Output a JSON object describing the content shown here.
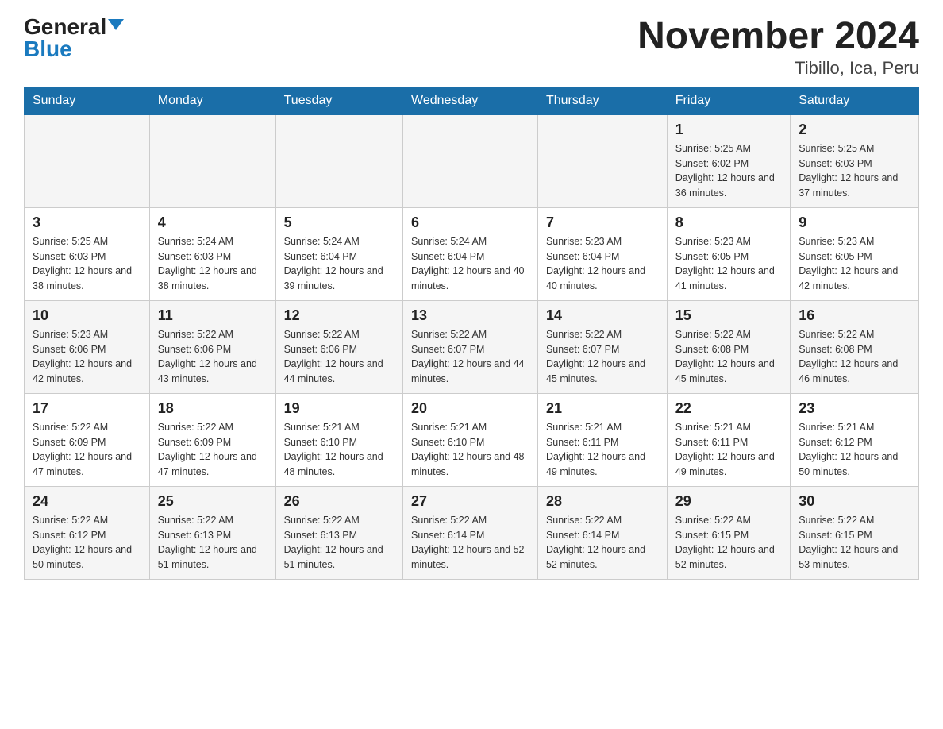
{
  "header": {
    "logo_general": "General",
    "logo_blue": "Blue",
    "title": "November 2024",
    "subtitle": "Tibillo, Ica, Peru"
  },
  "days_of_week": [
    "Sunday",
    "Monday",
    "Tuesday",
    "Wednesday",
    "Thursday",
    "Friday",
    "Saturday"
  ],
  "weeks": [
    [
      {
        "day": "",
        "sunrise": "",
        "sunset": "",
        "daylight": ""
      },
      {
        "day": "",
        "sunrise": "",
        "sunset": "",
        "daylight": ""
      },
      {
        "day": "",
        "sunrise": "",
        "sunset": "",
        "daylight": ""
      },
      {
        "day": "",
        "sunrise": "",
        "sunset": "",
        "daylight": ""
      },
      {
        "day": "",
        "sunrise": "",
        "sunset": "",
        "daylight": ""
      },
      {
        "day": "1",
        "sunrise": "Sunrise: 5:25 AM",
        "sunset": "Sunset: 6:02 PM",
        "daylight": "Daylight: 12 hours and 36 minutes."
      },
      {
        "day": "2",
        "sunrise": "Sunrise: 5:25 AM",
        "sunset": "Sunset: 6:03 PM",
        "daylight": "Daylight: 12 hours and 37 minutes."
      }
    ],
    [
      {
        "day": "3",
        "sunrise": "Sunrise: 5:25 AM",
        "sunset": "Sunset: 6:03 PM",
        "daylight": "Daylight: 12 hours and 38 minutes."
      },
      {
        "day": "4",
        "sunrise": "Sunrise: 5:24 AM",
        "sunset": "Sunset: 6:03 PM",
        "daylight": "Daylight: 12 hours and 38 minutes."
      },
      {
        "day": "5",
        "sunrise": "Sunrise: 5:24 AM",
        "sunset": "Sunset: 6:04 PM",
        "daylight": "Daylight: 12 hours and 39 minutes."
      },
      {
        "day": "6",
        "sunrise": "Sunrise: 5:24 AM",
        "sunset": "Sunset: 6:04 PM",
        "daylight": "Daylight: 12 hours and 40 minutes."
      },
      {
        "day": "7",
        "sunrise": "Sunrise: 5:23 AM",
        "sunset": "Sunset: 6:04 PM",
        "daylight": "Daylight: 12 hours and 40 minutes."
      },
      {
        "day": "8",
        "sunrise": "Sunrise: 5:23 AM",
        "sunset": "Sunset: 6:05 PM",
        "daylight": "Daylight: 12 hours and 41 minutes."
      },
      {
        "day": "9",
        "sunrise": "Sunrise: 5:23 AM",
        "sunset": "Sunset: 6:05 PM",
        "daylight": "Daylight: 12 hours and 42 minutes."
      }
    ],
    [
      {
        "day": "10",
        "sunrise": "Sunrise: 5:23 AM",
        "sunset": "Sunset: 6:06 PM",
        "daylight": "Daylight: 12 hours and 42 minutes."
      },
      {
        "day": "11",
        "sunrise": "Sunrise: 5:22 AM",
        "sunset": "Sunset: 6:06 PM",
        "daylight": "Daylight: 12 hours and 43 minutes."
      },
      {
        "day": "12",
        "sunrise": "Sunrise: 5:22 AM",
        "sunset": "Sunset: 6:06 PM",
        "daylight": "Daylight: 12 hours and 44 minutes."
      },
      {
        "day": "13",
        "sunrise": "Sunrise: 5:22 AM",
        "sunset": "Sunset: 6:07 PM",
        "daylight": "Daylight: 12 hours and 44 minutes."
      },
      {
        "day": "14",
        "sunrise": "Sunrise: 5:22 AM",
        "sunset": "Sunset: 6:07 PM",
        "daylight": "Daylight: 12 hours and 45 minutes."
      },
      {
        "day": "15",
        "sunrise": "Sunrise: 5:22 AM",
        "sunset": "Sunset: 6:08 PM",
        "daylight": "Daylight: 12 hours and 45 minutes."
      },
      {
        "day": "16",
        "sunrise": "Sunrise: 5:22 AM",
        "sunset": "Sunset: 6:08 PM",
        "daylight": "Daylight: 12 hours and 46 minutes."
      }
    ],
    [
      {
        "day": "17",
        "sunrise": "Sunrise: 5:22 AM",
        "sunset": "Sunset: 6:09 PM",
        "daylight": "Daylight: 12 hours and 47 minutes."
      },
      {
        "day": "18",
        "sunrise": "Sunrise: 5:22 AM",
        "sunset": "Sunset: 6:09 PM",
        "daylight": "Daylight: 12 hours and 47 minutes."
      },
      {
        "day": "19",
        "sunrise": "Sunrise: 5:21 AM",
        "sunset": "Sunset: 6:10 PM",
        "daylight": "Daylight: 12 hours and 48 minutes."
      },
      {
        "day": "20",
        "sunrise": "Sunrise: 5:21 AM",
        "sunset": "Sunset: 6:10 PM",
        "daylight": "Daylight: 12 hours and 48 minutes."
      },
      {
        "day": "21",
        "sunrise": "Sunrise: 5:21 AM",
        "sunset": "Sunset: 6:11 PM",
        "daylight": "Daylight: 12 hours and 49 minutes."
      },
      {
        "day": "22",
        "sunrise": "Sunrise: 5:21 AM",
        "sunset": "Sunset: 6:11 PM",
        "daylight": "Daylight: 12 hours and 49 minutes."
      },
      {
        "day": "23",
        "sunrise": "Sunrise: 5:21 AM",
        "sunset": "Sunset: 6:12 PM",
        "daylight": "Daylight: 12 hours and 50 minutes."
      }
    ],
    [
      {
        "day": "24",
        "sunrise": "Sunrise: 5:22 AM",
        "sunset": "Sunset: 6:12 PM",
        "daylight": "Daylight: 12 hours and 50 minutes."
      },
      {
        "day": "25",
        "sunrise": "Sunrise: 5:22 AM",
        "sunset": "Sunset: 6:13 PM",
        "daylight": "Daylight: 12 hours and 51 minutes."
      },
      {
        "day": "26",
        "sunrise": "Sunrise: 5:22 AM",
        "sunset": "Sunset: 6:13 PM",
        "daylight": "Daylight: 12 hours and 51 minutes."
      },
      {
        "day": "27",
        "sunrise": "Sunrise: 5:22 AM",
        "sunset": "Sunset: 6:14 PM",
        "daylight": "Daylight: 12 hours and 52 minutes."
      },
      {
        "day": "28",
        "sunrise": "Sunrise: 5:22 AM",
        "sunset": "Sunset: 6:14 PM",
        "daylight": "Daylight: 12 hours and 52 minutes."
      },
      {
        "day": "29",
        "sunrise": "Sunrise: 5:22 AM",
        "sunset": "Sunset: 6:15 PM",
        "daylight": "Daylight: 12 hours and 52 minutes."
      },
      {
        "day": "30",
        "sunrise": "Sunrise: 5:22 AM",
        "sunset": "Sunset: 6:15 PM",
        "daylight": "Daylight: 12 hours and 53 minutes."
      }
    ]
  ],
  "colors": {
    "header_bg": "#1a6ea8",
    "header_text": "#ffffff",
    "accent_blue": "#1a7abf"
  }
}
